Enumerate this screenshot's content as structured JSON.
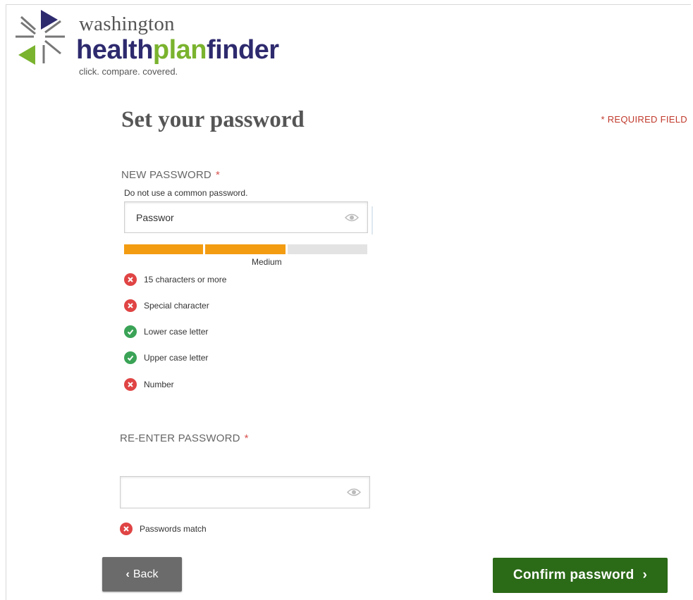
{
  "brand": {
    "name_top": "washington",
    "name_part1": "health",
    "name_part2": "plan",
    "name_part3": "finder",
    "tagline": "click. compare. covered.",
    "colors": {
      "navy": "#2e2a6e",
      "green": "#7ab32e",
      "gray": "#555555"
    }
  },
  "page": {
    "title": "Set your password",
    "required_note": "* REQUIRED FIELD"
  },
  "new_password": {
    "label": "NEW PASSWORD",
    "required_mark": "*",
    "hint": "Do not use a common password.",
    "value": "Passwor",
    "toggle_icon": "eye-icon",
    "strength": {
      "label": "Medium",
      "filled_segments": 2,
      "total_segments": 3,
      "fill_color": "#f39c12"
    }
  },
  "rules": [
    {
      "text": "15 characters or more",
      "status": "fail"
    },
    {
      "text": "Special character",
      "status": "fail"
    },
    {
      "text": "Lower case letter",
      "status": "pass"
    },
    {
      "text": "Upper case letter",
      "status": "pass"
    },
    {
      "text": "Number",
      "status": "fail"
    }
  ],
  "reenter_password": {
    "label": "RE-ENTER PASSWORD",
    "required_mark": "*",
    "value": "",
    "toggle_icon": "eye-icon",
    "match_rule": {
      "text": "Passwords match",
      "status": "fail"
    }
  },
  "buttons": {
    "back_label": "Back",
    "confirm_label": "Confirm password",
    "back_color": "#6b6b6b",
    "confirm_color": "#2b6a17"
  }
}
